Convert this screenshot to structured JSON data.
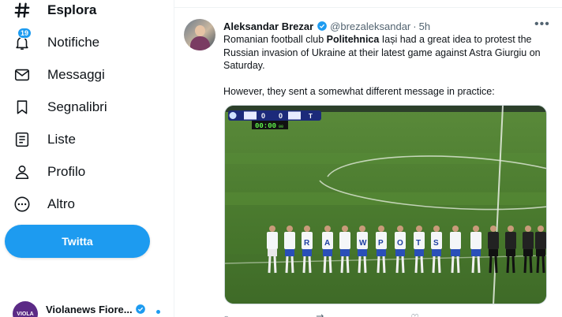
{
  "sidebar": {
    "items": [
      {
        "label": "Esplora",
        "icon": "hashtag-icon",
        "active": true
      },
      {
        "label": "Notifiche",
        "icon": "bell-icon",
        "badge": "19"
      },
      {
        "label": "Messaggi",
        "icon": "envelope-icon"
      },
      {
        "label": "Segnalibri",
        "icon": "bookmark-icon"
      },
      {
        "label": "Liste",
        "icon": "list-icon"
      },
      {
        "label": "Profilo",
        "icon": "person-icon"
      },
      {
        "label": "Altro",
        "icon": "more-circle-icon"
      }
    ],
    "tweet_button": "Twitta",
    "account": {
      "name": "Violanews Fiore...",
      "avatar_text": "VIOLA"
    }
  },
  "tweet": {
    "author_name": "Aleksandar Brezar",
    "handle": "@brezaleksandar",
    "separator": "·",
    "time": "5h",
    "text_before": "Romanian football club ",
    "text_bold": "Politehnica",
    "text_after": " Iași had a great idea to protest the Russian invasion of Ukraine at their latest game against Astra Giurgiu on Saturday.",
    "text_second": "However, they sent a somewhat different message in practice:",
    "scoreboard": {
      "score_left": "0",
      "score_right": "0",
      "clock": "00:00",
      "clock_small": "00",
      "tag": "T"
    },
    "banner_letters": [
      "R",
      "A",
      "W",
      "P",
      "O",
      "T",
      "S"
    ]
  },
  "colors": {
    "accent": "#1d9bf0",
    "text": "#0f1419",
    "muted": "#536471",
    "pitch": "#4a7a30"
  }
}
